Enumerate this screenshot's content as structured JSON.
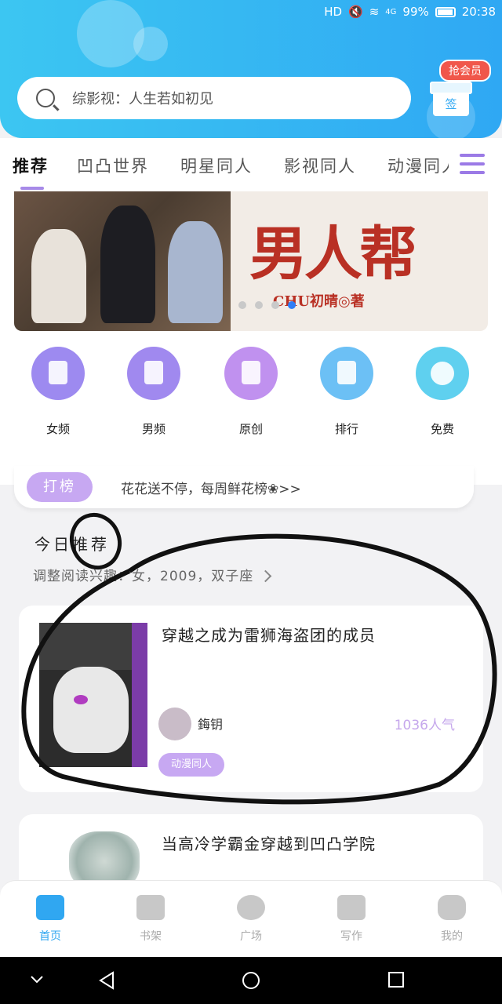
{
  "status_bar": {
    "network": "HD",
    "signal": "4G",
    "battery": "99%",
    "time": "20:38"
  },
  "search": {
    "placeholder": "综影视：人生若如初见"
  },
  "vip": {
    "badge": "抢会员",
    "gift_label": "签"
  },
  "tabs": [
    "推荐",
    "凹凸世界",
    "明星同人",
    "影视同人",
    "动漫同人"
  ],
  "banner": {
    "title": "男人帮",
    "author": "CHU初晴◎著",
    "slides": 4,
    "active_slide": 4
  },
  "categories": [
    {
      "label": "女频",
      "color": "#9d8af0",
      "icon": "dress-icon"
    },
    {
      "label": "男频",
      "color": "#a089ef",
      "icon": "shirt-icon"
    },
    {
      "label": "原创",
      "color": "#c091ef",
      "icon": "book-stand-icon"
    },
    {
      "label": "排行",
      "color": "#6cc0f5",
      "icon": "trophy-icon"
    },
    {
      "label": "免费",
      "color": "#5fd0ef",
      "icon": "yuan-coin-icon"
    }
  ],
  "rank": {
    "button": "打榜",
    "text": "花花送不停，每周鲜花榜❀>>"
  },
  "today": {
    "title": "今日推荐",
    "subtitle": "调整阅读兴趣：女，2009，双子座"
  },
  "books": [
    {
      "title": "穿越之成为雷狮海盗团的成员",
      "author": "鋂钥",
      "popularity": "1036人气",
      "tag": "动漫同人"
    },
    {
      "title": "当高冷学霸金穿越到凹凸学院",
      "author": "",
      "popularity": "",
      "tag": ""
    }
  ],
  "bottom_nav": [
    {
      "label": "首页",
      "icon": "home-icon",
      "active": true
    },
    {
      "label": "书架",
      "icon": "bookshelf-icon",
      "active": false
    },
    {
      "label": "广场",
      "icon": "planet-icon",
      "active": false
    },
    {
      "label": "写作",
      "icon": "pen-icon",
      "active": false
    },
    {
      "label": "我的",
      "icon": "chat-bubble-icon",
      "active": false
    }
  ],
  "colors": {
    "header": "#2fa8f3",
    "accent": "#c7a8f2",
    "active_nav": "#30a7f1"
  }
}
